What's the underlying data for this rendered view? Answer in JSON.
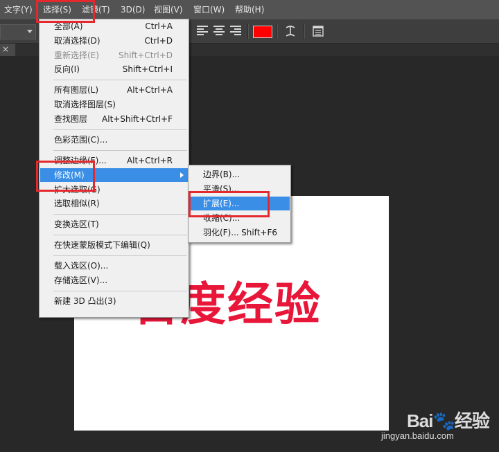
{
  "menubar": {
    "items": [
      {
        "label": "文字(Y)"
      },
      {
        "label": "选择(S)"
      },
      {
        "label": "滤镜(T)"
      },
      {
        "label": "3D(D)"
      },
      {
        "label": "视图(V)"
      },
      {
        "label": "窗口(W)"
      },
      {
        "label": "帮助(H)"
      }
    ]
  },
  "options": {
    "color": "#ff0000",
    "icons": [
      "align-left-icon",
      "align-center-icon",
      "align-right-icon",
      "warp-text-icon",
      "panels-icon"
    ]
  },
  "tab": {
    "close_label": "×"
  },
  "canvas": {
    "text": "百度经验"
  },
  "select_menu": {
    "groups": [
      [
        {
          "label": "全部(A)",
          "shortcut": "Ctrl+A"
        },
        {
          "label": "取消选择(D)",
          "shortcut": "Ctrl+D"
        },
        {
          "label": "重新选择(E)",
          "shortcut": "Shift+Ctrl+D",
          "disabled": true
        },
        {
          "label": "反向(I)",
          "shortcut": "Shift+Ctrl+I"
        }
      ],
      [
        {
          "label": "所有图层(L)",
          "shortcut": "Alt+Ctrl+A"
        },
        {
          "label": "取消选择图层(S)",
          "shortcut": ""
        },
        {
          "label": "查找图层",
          "shortcut": "Alt+Shift+Ctrl+F"
        }
      ],
      [
        {
          "label": "色彩范围(C)...",
          "shortcut": ""
        }
      ],
      [
        {
          "label": "调整边缘(F)...",
          "shortcut": "Alt+Ctrl+R"
        },
        {
          "label": "修改(M)",
          "shortcut": "",
          "highlighted": true,
          "submenu": true
        },
        {
          "label": "扩大选取(G)",
          "shortcut": ""
        },
        {
          "label": "选取相似(R)",
          "shortcut": ""
        }
      ],
      [
        {
          "label": "变换选区(T)",
          "shortcut": ""
        }
      ],
      [
        {
          "label": "在快速蒙版模式下编辑(Q)",
          "shortcut": ""
        }
      ],
      [
        {
          "label": "载入选区(O)...",
          "shortcut": ""
        },
        {
          "label": "存储选区(V)...",
          "shortcut": ""
        }
      ],
      [
        {
          "label": "新建 3D 凸出(3)",
          "shortcut": ""
        }
      ]
    ]
  },
  "modify_submenu": {
    "items": [
      {
        "label": "边界(B)...",
        "shortcut": ""
      },
      {
        "label": "平滑(S)...",
        "shortcut": ""
      },
      {
        "label": "扩展(E)...",
        "shortcut": "",
        "highlighted": true
      },
      {
        "label": "收缩(C)...",
        "shortcut": ""
      },
      {
        "label": "羽化(F)...",
        "shortcut": "Shift+F6"
      }
    ]
  },
  "watermark": {
    "brand": "Bai🐾经验",
    "url": "jingyan.baidu.com"
  }
}
